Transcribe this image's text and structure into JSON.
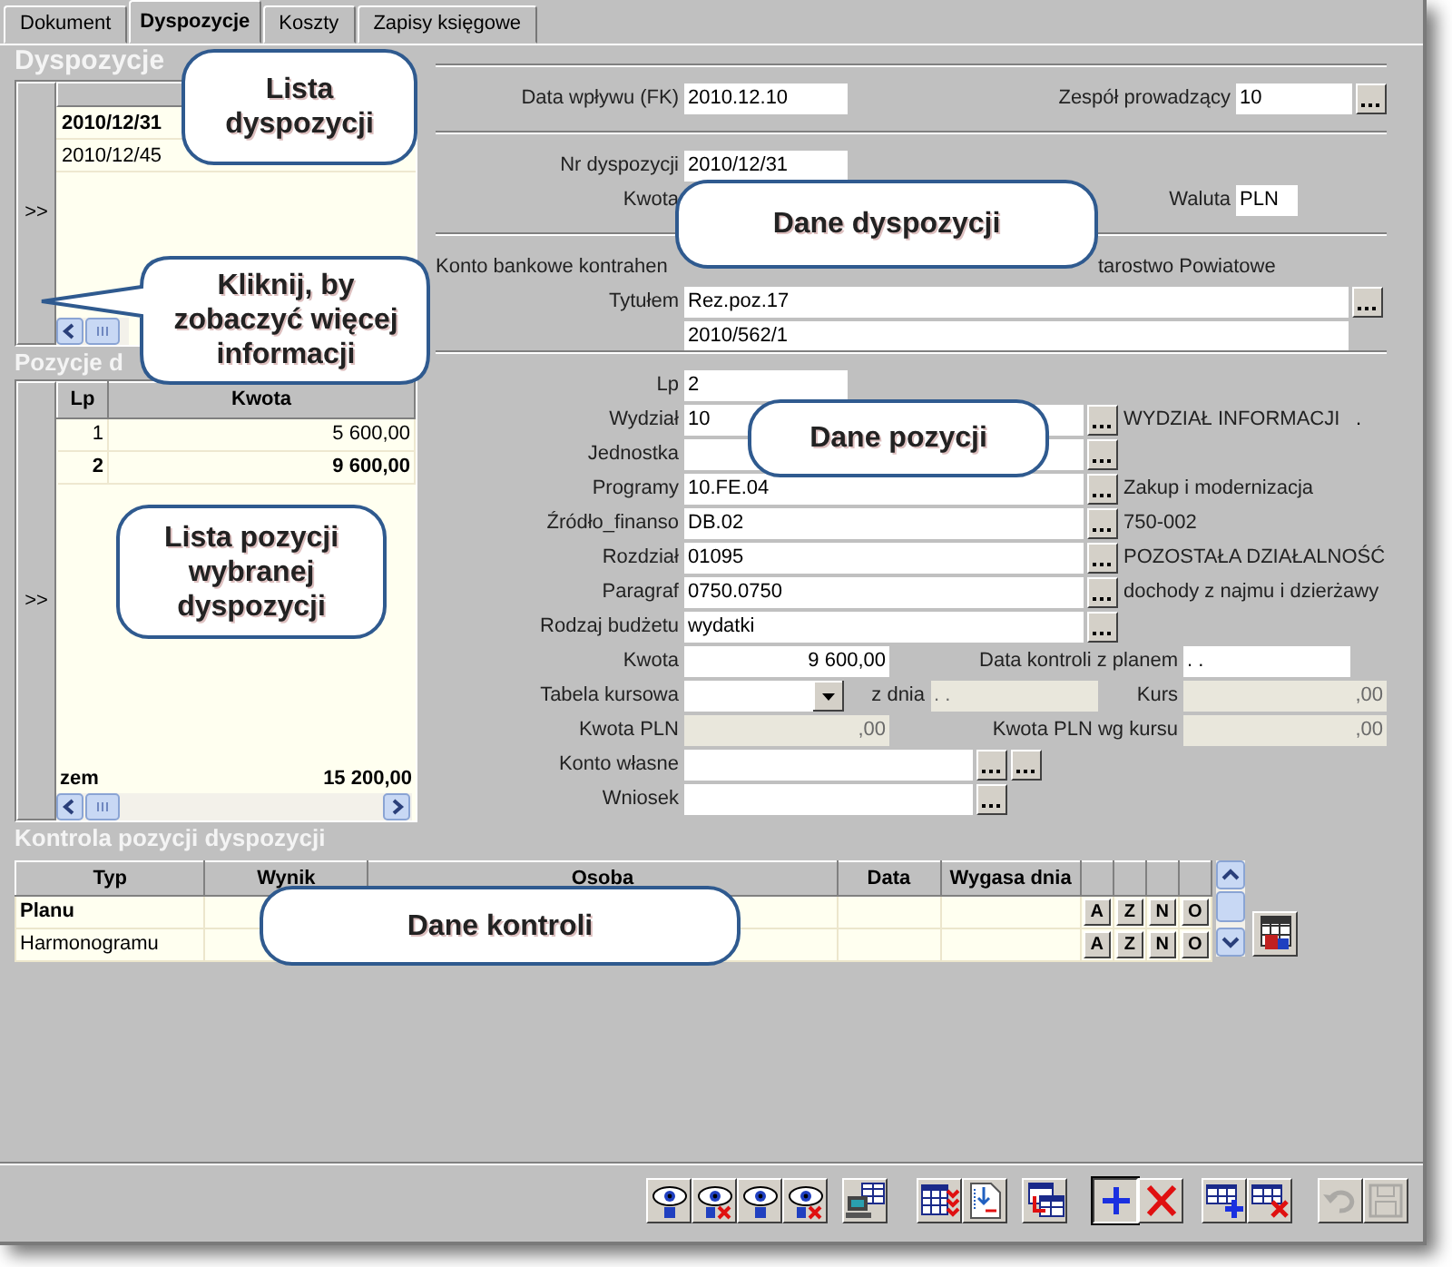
{
  "tabs": [
    {
      "label": "Dokument",
      "selected": false
    },
    {
      "label": "Dyspozycje",
      "selected": true
    },
    {
      "label": "Koszty",
      "selected": false
    },
    {
      "label": "Zapisy księgowe",
      "selected": false
    }
  ],
  "dispositions": {
    "title": "Dyspozycje",
    "expand": ">>",
    "rows": [
      {
        "number": "2010/12/31",
        "selected": true
      },
      {
        "number": "2010/12/45",
        "selected": false
      }
    ]
  },
  "disposition_form": [
    {
      "kind": "fields",
      "items": [
        {
          "kind": "code",
          "label": "Data wpływu (FK)",
          "value": "2010.12.10"
        },
        {
          "kind": "short",
          "label": "Zespół prowadzący",
          "value": "10",
          "browse": true
        }
      ]
    },
    {
      "kind": "divider"
    },
    {
      "kind": "fields",
      "items": [
        {
          "kind": "code",
          "label": "Nr dyspozycji",
          "value": "2010/12/31"
        }
      ]
    },
    {
      "kind": "fields",
      "items": [
        {
          "kind": "covered",
          "label": "Kwota"
        },
        {
          "kind": "currency",
          "label": "Waluta",
          "value": "PLN"
        }
      ]
    },
    {
      "kind": "divider"
    },
    {
      "kind": "notes",
      "items": [
        "Konto bankowe kontrahen",
        "tarostwo Powiatowe"
      ]
    },
    {
      "kind": "fields",
      "items": [
        {
          "kind": "long",
          "label": "Tytułem",
          "value": "Rez.poz.17",
          "browse": true
        }
      ]
    },
    {
      "kind": "fields",
      "items": [
        {
          "kind": "long",
          "value": "2010/562/1"
        }
      ]
    }
  ],
  "positions": {
    "title": "Pozycje d",
    "expand": ">>",
    "columns": [
      "Lp",
      "Kwota"
    ],
    "rows": [
      {
        "lp": "1",
        "amount": "5 600,00",
        "selected": false
      },
      {
        "lp": "2",
        "amount": "9 600,00",
        "selected": true
      }
    ],
    "footer": {
      "label": "zem",
      "total": "15 200,00"
    }
  },
  "position_form": [
    {
      "kind": "fields",
      "items": [
        {
          "kind": "code",
          "label": "Lp",
          "value": "2"
        }
      ]
    },
    {
      "kind": "fields",
      "items": [
        {
          "kind": "lookup",
          "label": "Wydział",
          "value": "10",
          "browse": true,
          "description": "WYDZIAŁ INFORMACJI",
          "suffix": "."
        }
      ]
    },
    {
      "kind": "fields",
      "items": [
        {
          "kind": "lookup",
          "label": "Jednostka",
          "browse": true
        }
      ]
    },
    {
      "kind": "fields",
      "items": [
        {
          "kind": "lookup",
          "label": "Programy",
          "value": "10.FE.04",
          "browse": true,
          "description": "Zakup i modernizacja"
        }
      ]
    },
    {
      "kind": "fields",
      "items": [
        {
          "kind": "lookup",
          "label": "Źródło_finanso",
          "value": "DB.02",
          "browse": true,
          "description": "750-002"
        }
      ]
    },
    {
      "kind": "fields",
      "items": [
        {
          "kind": "lookup",
          "label": "Rozdział",
          "value": "01095",
          "browse": true,
          "description": "POZOSTAŁA DZIAŁALNOŚĆ"
        }
      ]
    },
    {
      "kind": "fields",
      "items": [
        {
          "kind": "lookup",
          "label": "Paragraf",
          "value": "0750.0750",
          "browse": true,
          "description": "dochody z najmu i dzierżawy"
        }
      ]
    },
    {
      "kind": "fields",
      "items": [
        {
          "kind": "lookup",
          "label": "Rodzaj budżetu",
          "value": "wydatki",
          "browse": true
        }
      ]
    },
    {
      "kind": "fields",
      "items": [
        {
          "kind": "amount",
          "label": "Kwota",
          "value": "9 600,00",
          "disabled": false
        },
        {
          "kind": "date",
          "label": "Data kontroli z planem",
          "value": ". .",
          "disabled": false
        }
      ]
    },
    {
      "kind": "fields",
      "items": [
        {
          "kind": "select",
          "label": "Tabela kursowa",
          "disabled": false
        },
        {
          "kind": "date",
          "label": "z dnia",
          "value": ". .",
          "disabled": true
        },
        {
          "kind": "rate",
          "label": "Kurs",
          "value": ",00",
          "disabled": true
        }
      ]
    },
    {
      "kind": "fields",
      "items": [
        {
          "kind": "amount",
          "label": "Kwota PLN",
          "value": ",00",
          "disabled": true
        },
        {
          "kind": "rate",
          "label": "Kwota PLN wg kursu",
          "value": ",00",
          "disabled": true
        }
      ]
    },
    {
      "kind": "fields",
      "items": [
        {
          "kind": "account",
          "label": "Konto własne",
          "browse": true,
          "second_browse": true
        }
      ]
    },
    {
      "kind": "fields",
      "items": [
        {
          "kind": "account",
          "label": "Wniosek",
          "browse": true,
          "second_browse": false
        }
      ]
    }
  ],
  "control": {
    "title": "Kontrola pozycji dyspozycji",
    "columns": [
      "Typ",
      "Wynik",
      "Osoba",
      "Data",
      "Wygasa dnia"
    ],
    "rows": [
      {
        "type": "Planu",
        "selected": true,
        "actions": [
          "A",
          "Z",
          "N",
          "O"
        ]
      },
      {
        "type": "Harmonogramu",
        "selected": false,
        "actions": [
          "A",
          "Z",
          "N",
          "O"
        ]
      }
    ]
  },
  "toolbar": [
    {
      "kind": "eye",
      "disabled": false,
      "focused": false
    },
    {
      "kind": "eye-cross",
      "disabled": false,
      "focused": false
    },
    {
      "kind": "eye",
      "disabled": false,
      "focused": false
    },
    {
      "kind": "eye-cross",
      "disabled": false,
      "focused": false
    },
    {
      "kind": "computer-table",
      "disabled": false,
      "focused": false
    },
    {
      "kind": "table-check",
      "disabled": false,
      "focused": false
    },
    {
      "kind": "document-import",
      "disabled": false,
      "focused": false
    },
    {
      "kind": "table-copy",
      "disabled": false,
      "focused": false
    },
    {
      "kind": "plus",
      "disabled": false,
      "focused": true
    },
    {
      "kind": "cross",
      "disabled": false,
      "focused": false
    },
    {
      "kind": "table-plus",
      "disabled": false,
      "focused": false
    },
    {
      "kind": "table-cross",
      "disabled": false,
      "focused": false
    },
    {
      "kind": "undo",
      "disabled": true,
      "focused": false
    },
    {
      "kind": "save",
      "disabled": true,
      "focused": false
    }
  ],
  "callouts": [
    {
      "text": "Lista dyspozycji",
      "kind": "plain"
    },
    {
      "text": "Dane dyspozycji",
      "kind": "plain"
    },
    {
      "text": "Kliknij, by zobaczyć więcej informacji",
      "kind": "pointer"
    },
    {
      "text": "Dane pozycji",
      "kind": "plain"
    },
    {
      "text": "Lista pozycji wybranej dyspozycji",
      "kind": "plain"
    },
    {
      "text": "Dane kontroli",
      "kind": "plain"
    }
  ]
}
